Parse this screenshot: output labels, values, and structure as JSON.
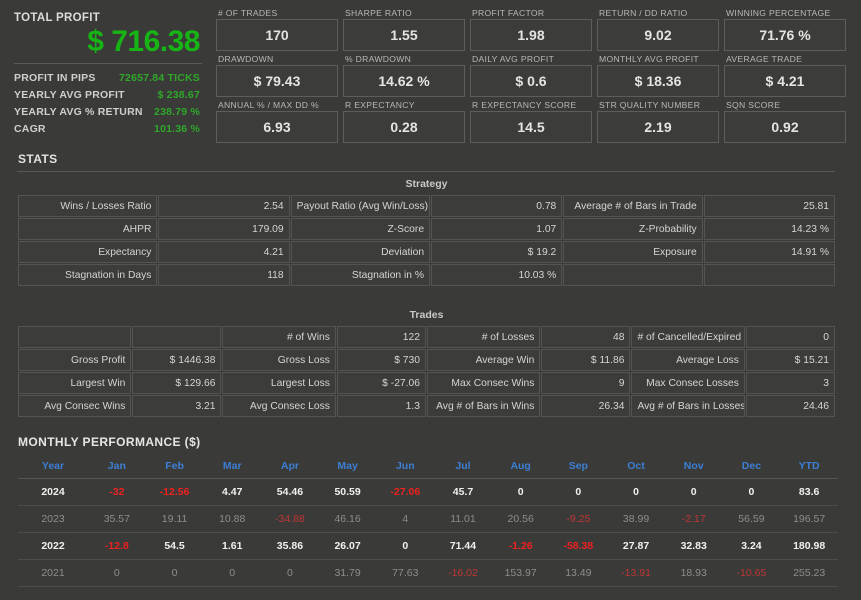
{
  "summary": {
    "title": "TOTAL PROFIT",
    "amount": "$ 716.38",
    "rows": [
      {
        "label": "PROFIT IN PIPS",
        "value": "72657.84 TICKS"
      },
      {
        "label": "YEARLY AVG PROFIT",
        "value": "$ 238.67"
      },
      {
        "label": "YEARLY AVG % RETURN",
        "value": "238.79 %"
      },
      {
        "label": "CAGR",
        "value": "101.36 %"
      }
    ],
    "accent_color": "#16b515"
  },
  "cards": [
    {
      "label": "# OF TRADES",
      "value": "170"
    },
    {
      "label": "SHARPE RATIO",
      "value": "1.55"
    },
    {
      "label": "PROFIT FACTOR",
      "value": "1.98"
    },
    {
      "label": "RETURN / DD RATIO",
      "value": "9.02"
    },
    {
      "label": "WINNING PERCENTAGE",
      "value": "71.76 %"
    },
    {
      "label": "DRAWDOWN",
      "value": "$ 79.43"
    },
    {
      "label": "% DRAWDOWN",
      "value": "14.62 %"
    },
    {
      "label": "DAILY AVG PROFIT",
      "value": "$ 0.6"
    },
    {
      "label": "MONTHLY AVG PROFIT",
      "value": "$ 18.36"
    },
    {
      "label": "AVERAGE TRADE",
      "value": "$ 4.21"
    },
    {
      "label": "ANNUAL % / MAX DD %",
      "value": "6.93"
    },
    {
      "label": "R EXPECTANCY",
      "value": "0.28"
    },
    {
      "label": "R EXPECTANCY SCORE",
      "value": "14.5"
    },
    {
      "label": "STR QUALITY NUMBER",
      "value": "2.19"
    },
    {
      "label": "SQN SCORE",
      "value": "0.92"
    }
  ],
  "stats": {
    "heading": "STATS",
    "strategy": {
      "title": "Strategy",
      "rows": [
        [
          "Wins / Losses Ratio",
          "2.54",
          "Payout Ratio (Avg Win/Loss)",
          "0.78",
          "Average # of Bars in Trade",
          "25.81"
        ],
        [
          "AHPR",
          "179.09",
          "Z-Score",
          "1.07",
          "Z-Probability",
          "14.23 %"
        ],
        [
          "Expectancy",
          "4.21",
          "Deviation",
          "$ 19.2",
          "Exposure",
          "14.91 %"
        ],
        [
          "Stagnation in Days",
          "118",
          "Stagnation in %",
          "10.03 %",
          "",
          ""
        ]
      ]
    },
    "trades": {
      "title": "Trades",
      "rows": [
        [
          "",
          "",
          "# of Wins",
          "122",
          "# of Losses",
          "48",
          "# of Cancelled/Expired",
          "0"
        ],
        [
          "Gross Profit",
          "$ 1446.38",
          "Gross Loss",
          "$ 730",
          "Average Win",
          "$ 11.86",
          "Average Loss",
          "$ 15.21"
        ],
        [
          "Largest Win",
          "$ 129.66",
          "Largest Loss",
          "$ -27.06",
          "Max Consec Wins",
          "9",
          "Max Consec Losses",
          "3"
        ],
        [
          "Avg Consec Wins",
          "3.21",
          "Avg Consec Loss",
          "1.3",
          "Avg # of Bars in Wins",
          "26.34",
          "Avg # of Bars in Losses",
          "24.46"
        ]
      ]
    }
  },
  "monthly": {
    "heading": "MONTHLY PERFORMANCE ($)",
    "columns": [
      "Year",
      "Jan",
      "Feb",
      "Mar",
      "Apr",
      "May",
      "Jun",
      "Jul",
      "Aug",
      "Sep",
      "Oct",
      "Nov",
      "Dec",
      "YTD"
    ],
    "header_color": "#3c7fd4",
    "negative_color": "#ef2020",
    "rows": [
      {
        "style": "bright",
        "cells": [
          "2024",
          "-32",
          "-12.56",
          "4.47",
          "54.46",
          "50.59",
          "-27.06",
          "45.7",
          "0",
          "0",
          "0",
          "0",
          "0",
          "83.6"
        ]
      },
      {
        "style": "dim",
        "cells": [
          "2023",
          "35.57",
          "19.11",
          "10.88",
          "-34.88",
          "46.16",
          "4",
          "11.01",
          "20.56",
          "-9.25",
          "38.99",
          "-2.17",
          "56.59",
          "196.57"
        ]
      },
      {
        "style": "bright",
        "cells": [
          "2022",
          "-12.8",
          "54.5",
          "1.61",
          "35.86",
          "26.07",
          "0",
          "71.44",
          "-1.26",
          "-58.38",
          "27.87",
          "32.83",
          "3.24",
          "180.98"
        ]
      },
      {
        "style": "dim",
        "cells": [
          "2021",
          "0",
          "0",
          "0",
          "0",
          "31.79",
          "77.63",
          "-16.02",
          "153.97",
          "13.49",
          "-13.91",
          "18.93",
          "-10.65",
          "255.23"
        ]
      }
    ]
  }
}
